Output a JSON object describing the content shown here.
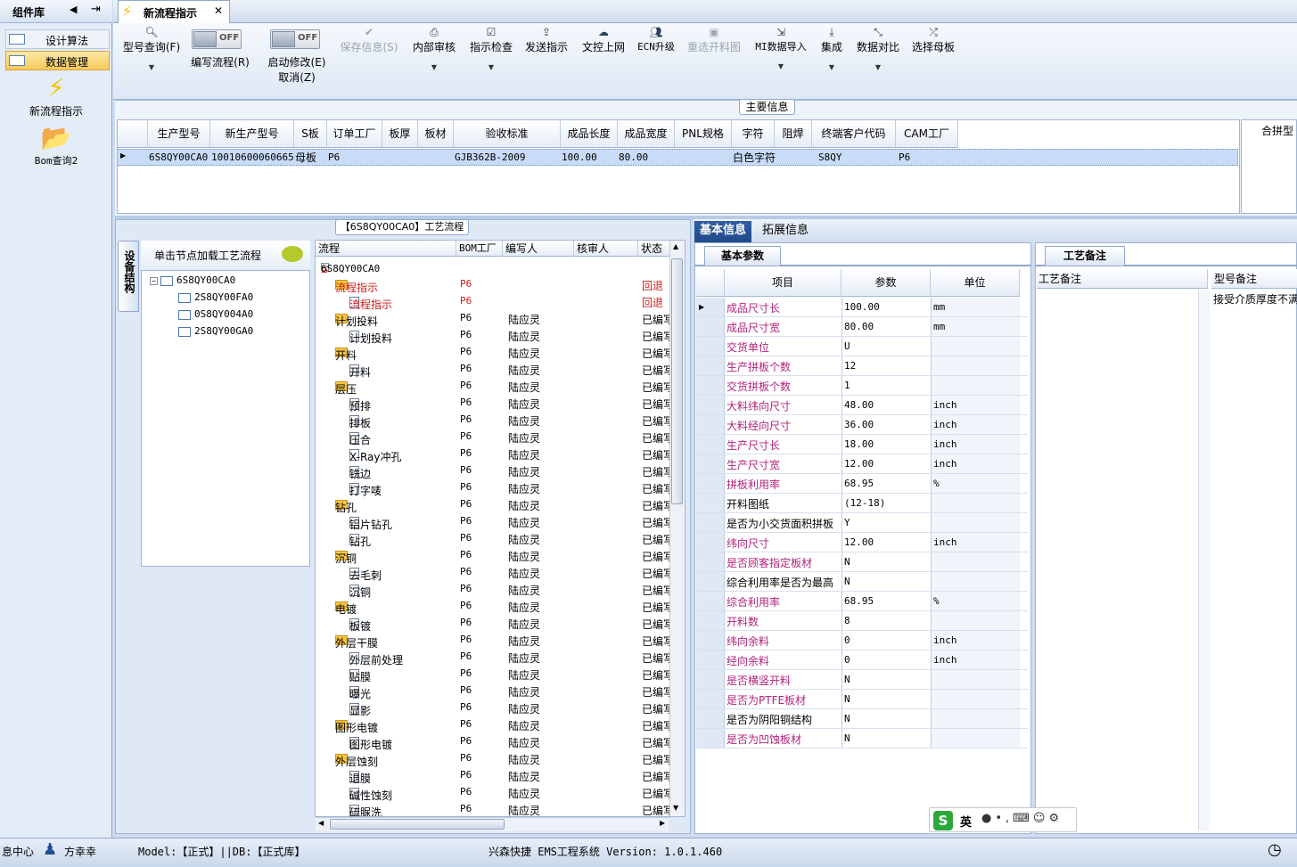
{
  "left_panel": {
    "title": "组件库",
    "items": [
      {
        "label": "设计算法"
      },
      {
        "label": "数据管理"
      }
    ],
    "shortcuts": [
      {
        "label": "新流程指示"
      },
      {
        "label": "Bom查询2"
      }
    ]
  },
  "tab": {
    "title": "新流程指示"
  },
  "toolbar": {
    "model_query": "型号查询(F)",
    "write_flow": "编写流程(R)",
    "write_flow_toggle": "OFF",
    "start_modify": "启动修改(E)",
    "start_modify_toggle": "OFF",
    "cancel": "取消(Z)",
    "save_info": "保存信息(S)",
    "internal_review": "内部审核",
    "check_instruction": "指示检查",
    "send_instruction": "发送指示",
    "upload_doc": "文控上网",
    "ecn_upgrade": "ECN升级",
    "reselect_cut_chart": "重选开料图",
    "mi_import": "MI数据导入",
    "integrate": "集成",
    "data_compare": "数据对比",
    "select_mother": "选择母板"
  },
  "main_info": {
    "label": "主要信息",
    "columns": [
      "生产型号",
      "新生产型号",
      "S板",
      "订单工厂",
      "板厚",
      "板材",
      "验收标准",
      "成品长度",
      "成品宽度",
      "PNL规格",
      "字符",
      "阻焊",
      "终端客户代码",
      "CAM工厂"
    ],
    "row": [
      "6S8QY00CA0",
      "10010600060665",
      "母板",
      "P6",
      "",
      "",
      "GJB362B-2009",
      "100.00",
      "80.00",
      "",
      "白色字符",
      "",
      "S8QY",
      "P6"
    ],
    "side_label": "合拼型"
  },
  "flow_panel": {
    "label": "【6S8QY00CA0】工艺流程",
    "vertical_tab": "设备结构",
    "tree_header": "单击节点加载工艺流程",
    "tree_nodes": [
      "6S8QY00CA0",
      "2S8QY00FA0",
      "0S8QY004A0",
      "2S8QY00GA0"
    ],
    "grid_columns": [
      "流程",
      "BOM工厂",
      "编写人",
      "核审人",
      "状态"
    ],
    "root": "6S8QY00CA0",
    "rows": [
      {
        "name": "流程指示",
        "factory": "P6",
        "writer": "",
        "status": "回退",
        "red": true,
        "folder": true
      },
      {
        "name": "流程指示",
        "factory": "P6",
        "writer": "",
        "status": "回退",
        "red": true,
        "folder": false
      },
      {
        "name": "计划投料",
        "factory": "P6",
        "writer": "陆应灵",
        "status": "已编写",
        "folder": true
      },
      {
        "name": "计划投料",
        "factory": "P6",
        "writer": "陆应灵",
        "status": "已编写",
        "folder": false
      },
      {
        "name": "开料",
        "factory": "P6",
        "writer": "陆应灵",
        "status": "已编写",
        "folder": true
      },
      {
        "name": "开料",
        "factory": "P6",
        "writer": "陆应灵",
        "status": "已编写",
        "folder": false
      },
      {
        "name": "层压",
        "factory": "P6",
        "writer": "陆应灵",
        "status": "已编写",
        "folder": true
      },
      {
        "name": "预排",
        "factory": "P6",
        "writer": "陆应灵",
        "status": "已编写",
        "folder": false
      },
      {
        "name": "排板",
        "factory": "P6",
        "writer": "陆应灵",
        "status": "已编写",
        "folder": false
      },
      {
        "name": "压合",
        "factory": "P6",
        "writer": "陆应灵",
        "status": "已编写",
        "folder": false
      },
      {
        "name": "X-Ray冲孔",
        "factory": "P6",
        "writer": "陆应灵",
        "status": "已编写",
        "folder": false
      },
      {
        "name": "铣边",
        "factory": "P6",
        "writer": "陆应灵",
        "status": "已编写",
        "folder": false
      },
      {
        "name": "打字唛",
        "factory": "P6",
        "writer": "陆应灵",
        "status": "已编写",
        "folder": false
      },
      {
        "name": "钻孔",
        "factory": "P6",
        "writer": "陆应灵",
        "status": "已编写",
        "folder": true
      },
      {
        "name": "铝片钻孔",
        "factory": "P6",
        "writer": "陆应灵",
        "status": "已编写",
        "folder": false
      },
      {
        "name": "钻孔",
        "factory": "P6",
        "writer": "陆应灵",
        "status": "已编写",
        "folder": false
      },
      {
        "name": "沉铜",
        "factory": "P6",
        "writer": "陆应灵",
        "status": "已编写",
        "folder": true
      },
      {
        "name": "去毛刺",
        "factory": "P6",
        "writer": "陆应灵",
        "status": "已编写",
        "folder": false
      },
      {
        "name": "沉铜",
        "factory": "P6",
        "writer": "陆应灵",
        "status": "已编写",
        "folder": false
      },
      {
        "name": "电镀",
        "factory": "P6",
        "writer": "陆应灵",
        "status": "已编写",
        "folder": true
      },
      {
        "name": "板镀",
        "factory": "P6",
        "writer": "陆应灵",
        "status": "已编写",
        "folder": false
      },
      {
        "name": "外层干膜",
        "factory": "P6",
        "writer": "陆应灵",
        "status": "已编写",
        "folder": true
      },
      {
        "name": "外层前处理",
        "factory": "P6",
        "writer": "陆应灵",
        "status": "已编写",
        "folder": false
      },
      {
        "name": "贴膜",
        "factory": "P6",
        "writer": "陆应灵",
        "status": "已编写",
        "folder": false
      },
      {
        "name": "曝光",
        "factory": "P6",
        "writer": "陆应灵",
        "status": "已编写",
        "folder": false
      },
      {
        "name": "显影",
        "factory": "P6",
        "writer": "陆应灵",
        "status": "已编写",
        "folder": false
      },
      {
        "name": "图形电镀",
        "factory": "P6",
        "writer": "陆应灵",
        "status": "已编写",
        "folder": true
      },
      {
        "name": "图形电镀",
        "factory": "P6",
        "writer": "陆应灵",
        "status": "已编写",
        "folder": false
      },
      {
        "name": "外层蚀刻",
        "factory": "P6",
        "writer": "陆应灵",
        "status": "已编写",
        "folder": true
      },
      {
        "name": "退膜",
        "factory": "P6",
        "writer": "陆应灵",
        "status": "已编写",
        "folder": false
      },
      {
        "name": "碱性蚀刻",
        "factory": "P6",
        "writer": "陆应灵",
        "status": "已编写",
        "folder": false
      },
      {
        "name": "硫脲洗",
        "factory": "P6",
        "writer": "陆应灵",
        "status": "已编写",
        "folder": false
      }
    ]
  },
  "right_tabs": {
    "basic": "基本信息",
    "extended": "拓展信息"
  },
  "basic_params": {
    "subtab": "基本参数",
    "columns": [
      "项目",
      "参数",
      "单位"
    ],
    "rows": [
      {
        "name": "成品尺寸长",
        "value": "100.00",
        "unit": "mm",
        "pink": true
      },
      {
        "name": "成品尺寸宽",
        "value": "80.00",
        "unit": "mm",
        "pink": true
      },
      {
        "name": "交货单位",
        "value": "U",
        "unit": "",
        "pink": true
      },
      {
        "name": "生产拼板个数",
        "value": "12",
        "unit": "",
        "pink": true
      },
      {
        "name": "交货拼板个数",
        "value": "1",
        "unit": "",
        "pink": true
      },
      {
        "name": "大料纬向尺寸",
        "value": "48.00",
        "unit": "inch",
        "pink": true
      },
      {
        "name": "大料经向尺寸",
        "value": "36.00",
        "unit": "inch",
        "pink": true
      },
      {
        "name": "生产尺寸长",
        "value": "18.00",
        "unit": "inch",
        "pink": true
      },
      {
        "name": "生产尺寸宽",
        "value": "12.00",
        "unit": "inch",
        "pink": true
      },
      {
        "name": "拼板利用率",
        "value": "68.95",
        "unit": "%",
        "pink": true
      },
      {
        "name": "开料图纸",
        "value": "(12-18)",
        "unit": "",
        "pink": false
      },
      {
        "name": "是否为小交货面积拼板",
        "value": "Y",
        "unit": "",
        "pink": false
      },
      {
        "name": "纬向尺寸",
        "value": "12.00",
        "unit": "inch",
        "pink": true
      },
      {
        "name": "是否顾客指定板材",
        "value": "N",
        "unit": "",
        "pink": true
      },
      {
        "name": "综合利用率是否为最高",
        "value": "N",
        "unit": "",
        "pink": false
      },
      {
        "name": "综合利用率",
        "value": "68.95",
        "unit": "%",
        "pink": true
      },
      {
        "name": "开料数",
        "value": "8",
        "unit": "",
        "pink": true
      },
      {
        "name": "纬向余料",
        "value": "0",
        "unit": "inch",
        "pink": true
      },
      {
        "name": "经向余料",
        "value": "0",
        "unit": "inch",
        "pink": true
      },
      {
        "name": "是否横竖开料",
        "value": "N",
        "unit": "",
        "pink": true
      },
      {
        "name": "是否为PTFE板材",
        "value": "N",
        "unit": "",
        "pink": true
      },
      {
        "name": "是否为阴阳铜结构",
        "value": "N",
        "unit": "",
        "pink": false
      },
      {
        "name": "是否为凹蚀板材",
        "value": "N",
        "unit": "",
        "pink": true
      }
    ]
  },
  "notes": {
    "tab": "工艺备注",
    "col1": "工艺备注",
    "col2": "型号备注",
    "value2": "接受介质厚度不满"
  },
  "ime": {
    "label": "英"
  },
  "status": {
    "left": "息中心",
    "user": "方幸幸",
    "model": "Model:【正式】||DB:【正式库】",
    "app": "兴森快捷 EMS工程系统 Version: 1.0.1.460"
  }
}
